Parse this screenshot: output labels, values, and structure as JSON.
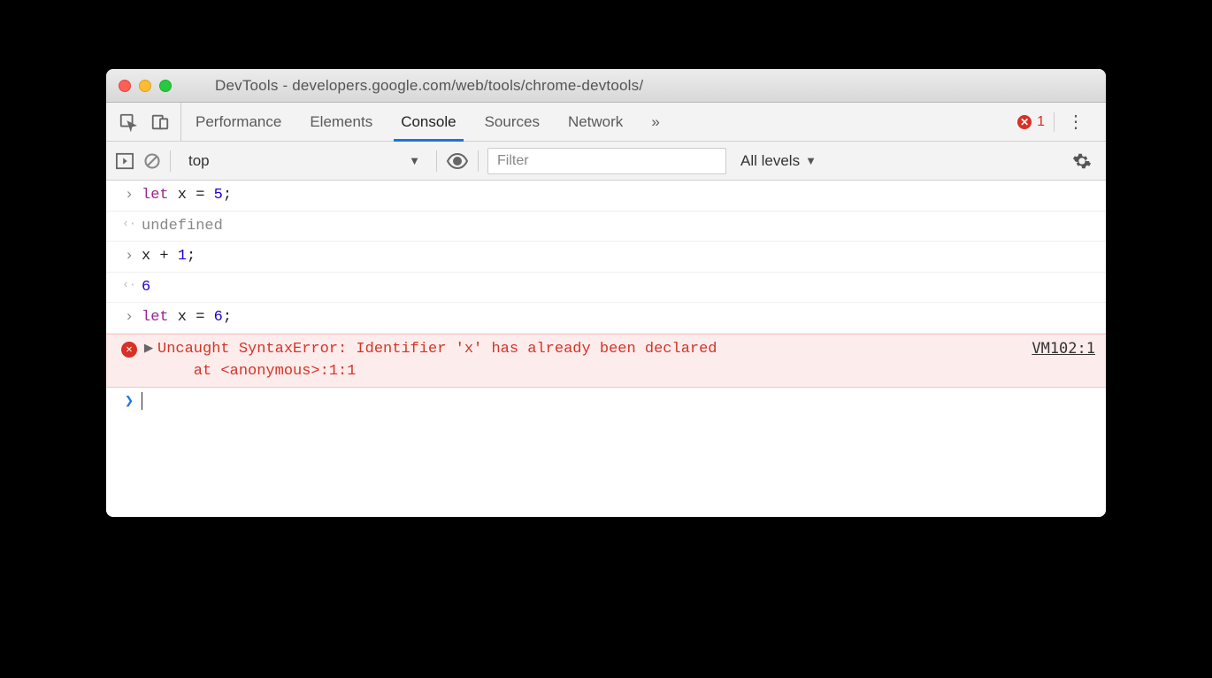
{
  "window": {
    "title": "DevTools - developers.google.com/web/tools/chrome-devtools/"
  },
  "tabs": {
    "items": [
      "Performance",
      "Elements",
      "Console",
      "Sources",
      "Network"
    ],
    "active": "Console",
    "overflow": "»",
    "error_count": "1"
  },
  "toolbar": {
    "context": "top",
    "filter_placeholder": "Filter",
    "levels": "All levels"
  },
  "console": {
    "lines": [
      {
        "type": "in",
        "tokens": [
          [
            "kw",
            "let"
          ],
          [
            "plain",
            " x "
          ],
          [
            "plain",
            "= "
          ],
          [
            "num",
            "5"
          ],
          [
            "plain",
            ";"
          ]
        ]
      },
      {
        "type": "out",
        "plain": "undefined",
        "cls": "undef"
      },
      {
        "type": "in",
        "tokens": [
          [
            "plain",
            "x + "
          ],
          [
            "num",
            "1"
          ],
          [
            "plain",
            ";"
          ]
        ]
      },
      {
        "type": "out",
        "plain": "6",
        "cls": "num"
      },
      {
        "type": "in",
        "tokens": [
          [
            "kw",
            "let"
          ],
          [
            "plain",
            " x "
          ],
          [
            "plain",
            "= "
          ],
          [
            "num",
            "6"
          ],
          [
            "plain",
            ";"
          ]
        ]
      }
    ],
    "error": {
      "message": "Uncaught SyntaxError: Identifier 'x' has already been declared\n    at <anonymous>:1:1",
      "source": "VM102:1"
    }
  }
}
